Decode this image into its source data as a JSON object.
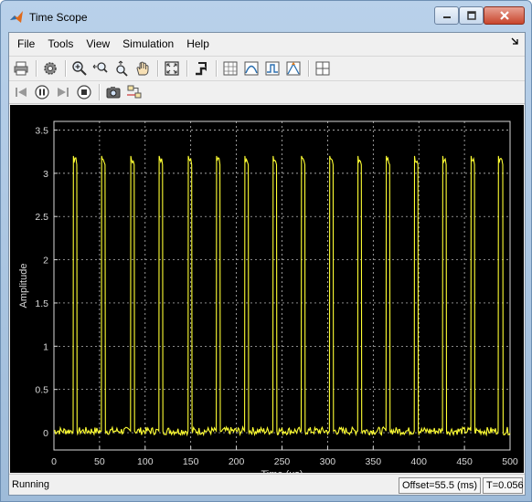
{
  "window": {
    "title": "Time Scope",
    "icons": {
      "app": "matlab-logo-icon",
      "minimize": "minimize-icon",
      "maximize": "maximize-icon",
      "close": "close-icon"
    }
  },
  "menu": {
    "items": [
      "File",
      "Tools",
      "View",
      "Simulation",
      "Help"
    ],
    "dock_icon": "dock-arrow-icon"
  },
  "toolbar1": {
    "icons": [
      "print-icon",
      "settings-icon",
      "zoom-in-icon",
      "zoom-x-icon",
      "zoom-y-icon",
      "pan-hand-icon",
      "scale-axes-icon",
      "highlight-simulink-icon",
      "cursor-measurements-icon",
      "signal-statistics-icon",
      "bilevel-measurements-icon",
      "peak-finder-icon",
      "layout-icon"
    ]
  },
  "toolbar2": {
    "icons": [
      "step-back-icon",
      "pause-icon",
      "step-forward-icon",
      "stop-icon",
      "snapshot-icon",
      "simulink-model-icon"
    ]
  },
  "scope": {
    "colors": {
      "background": "#000000",
      "trace": "#ffff33",
      "axes": "#d9d9d9",
      "grid": "#d9d9d9"
    }
  },
  "chart_data": {
    "type": "line",
    "xlabel": "Time (us)",
    "ylabel": "Amplitude",
    "xlim": [
      0,
      500
    ],
    "ylim": [
      -0.2,
      3.6
    ],
    "xticks": [
      "0",
      "50",
      "100",
      "150",
      "200",
      "250",
      "300",
      "350",
      "400",
      "450",
      "500"
    ],
    "yticks": [
      "0",
      "0.5",
      "1",
      "1.5",
      "2",
      "2.5",
      "3",
      "3.5"
    ],
    "grid": true,
    "low_level": 0.02,
    "high_level": 3.15,
    "pulses": [
      {
        "start": 21,
        "end": 25
      },
      {
        "start": 52,
        "end": 56
      },
      {
        "start": 84,
        "end": 88
      },
      {
        "start": 115,
        "end": 119
      },
      {
        "start": 147,
        "end": 151
      },
      {
        "start": 178,
        "end": 182
      },
      {
        "start": 209,
        "end": 213
      },
      {
        "start": 240,
        "end": 244
      },
      {
        "start": 271,
        "end": 275
      },
      {
        "start": 302,
        "end": 306
      },
      {
        "start": 333,
        "end": 337
      },
      {
        "start": 364,
        "end": 368
      },
      {
        "start": 395,
        "end": 399
      },
      {
        "start": 426,
        "end": 430
      },
      {
        "start": 457,
        "end": 461
      },
      {
        "start": 487,
        "end": 492
      }
    ]
  },
  "status": {
    "text": "Running",
    "offset": "Offset=55.5 (ms)",
    "time": "T=0.056"
  }
}
